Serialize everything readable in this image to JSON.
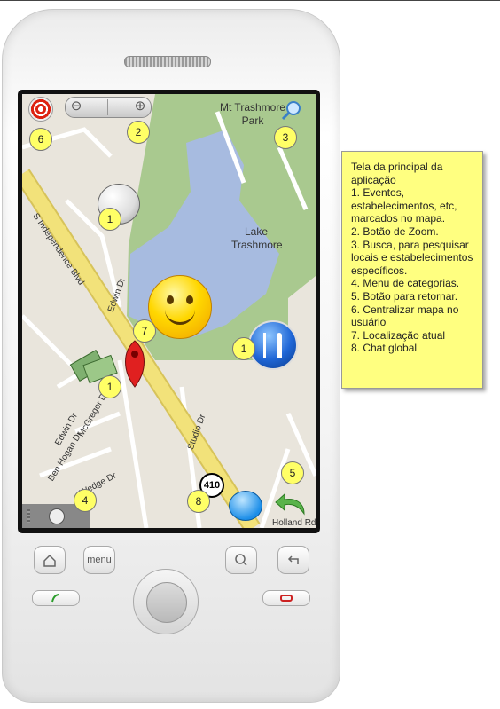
{
  "map": {
    "labels": {
      "mt_trashmore": "Mt Trashmore\nPark",
      "lake": "Lake\nTrashmore",
      "s_independence": "S Independence Blvd",
      "edwin_dr_1": "Edwin Dr",
      "edwin_dr_2": "Edwin Dr",
      "studio_dr": "Studio Dr",
      "mcgregor": "McGregor Dr",
      "ben_hogan": "Ben Hogan Dr",
      "wedge": "Wedge Dr",
      "holland": "Holland Rd",
      "route_410": "410"
    }
  },
  "buttons": {
    "menu_label": "menu"
  },
  "badges": [
    "6",
    "2",
    "3",
    "1",
    "1",
    "7",
    "1",
    "4",
    "8",
    "5"
  ],
  "note": {
    "lines": [
      "Tela da principal da aplicação",
      "1. Eventos, estabelecimentos, etc, marcados no mapa.",
      "2. Botão de Zoom.",
      "3. Busca, para pesquisar locais e estabelecimentos específicos.",
      "4. Menu de categorias.",
      "5. Botão para retornar.",
      "6. Centralizar mapa no usuário",
      "7. Localização atual",
      "8. Chat global"
    ]
  },
  "colors": {
    "note_bg": "#ffff80",
    "badge_bg": "#ffff66",
    "road": "#f2e27a",
    "park": "#a9c98f",
    "lake": "#a7bbe0"
  }
}
